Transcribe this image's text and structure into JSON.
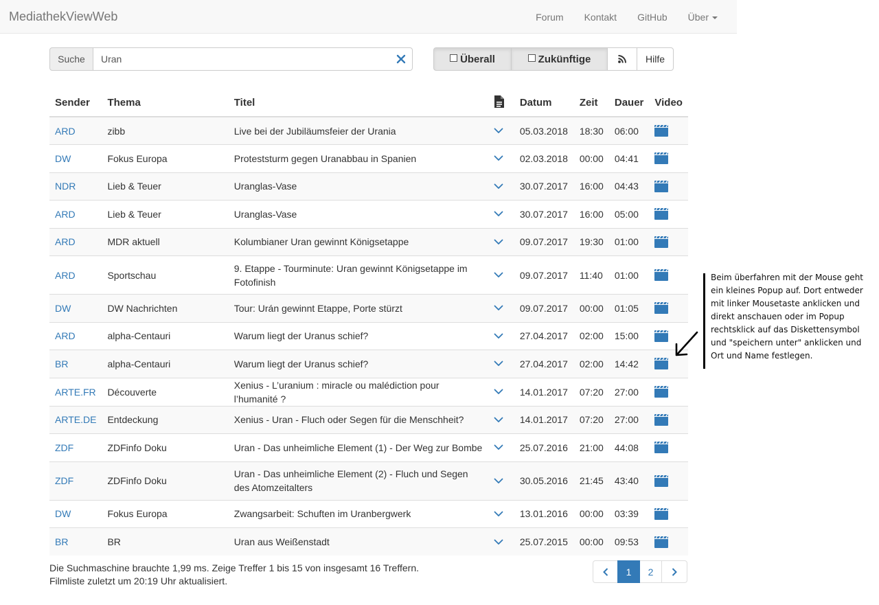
{
  "navbar": {
    "brand": "MediathekViewWeb",
    "links": [
      "Forum",
      "Kontakt",
      "GitHub",
      "Über"
    ]
  },
  "search": {
    "addon_label": "Suche",
    "value": "Uran",
    "clear_icon": "close-icon"
  },
  "toolbar": {
    "everywhere_label": "Überall",
    "future_label": "Zukünftige",
    "rss_icon": "rss-icon",
    "help_label": "Hilfe"
  },
  "table": {
    "headers": {
      "sender": "Sender",
      "thema": "Thema",
      "titel": "Titel",
      "description_icon": "document-icon",
      "datum": "Datum",
      "zeit": "Zeit",
      "dauer": "Dauer",
      "video": "Video"
    },
    "rows": [
      {
        "sender": "ARD",
        "thema": "zibb",
        "titel": "Live bei der Jubiläumsfeier der Urania",
        "datum": "05.03.2018",
        "zeit": "18:30",
        "dauer": "06:00"
      },
      {
        "sender": "DW",
        "thema": "Fokus Europa",
        "titel": "Proteststurm gegen Uranabbau in Spanien",
        "datum": "02.03.2018",
        "zeit": "00:00",
        "dauer": "04:41"
      },
      {
        "sender": "NDR",
        "thema": "Lieb & Teuer",
        "titel": "Uranglas-Vase",
        "datum": "30.07.2017",
        "zeit": "16:00",
        "dauer": "04:43"
      },
      {
        "sender": "ARD",
        "thema": "Lieb & Teuer",
        "titel": "Uranglas-Vase",
        "datum": "30.07.2017",
        "zeit": "16:00",
        "dauer": "05:00"
      },
      {
        "sender": "ARD",
        "thema": "MDR aktuell",
        "titel": "Kolumbianer Uran gewinnt Königsetappe",
        "datum": "09.07.2017",
        "zeit": "19:30",
        "dauer": "01:00"
      },
      {
        "sender": "ARD",
        "thema": "Sportschau",
        "titel": "9. Etappe - Tourminute: Uran gewinnt Königsetappe im Fotofinish",
        "datum": "09.07.2017",
        "zeit": "11:40",
        "dauer": "01:00"
      },
      {
        "sender": "DW",
        "thema": "DW Nachrichten",
        "titel": "Tour: Urán gewinnt Etappe, Porte stürzt",
        "datum": "09.07.2017",
        "zeit": "00:00",
        "dauer": "01:05"
      },
      {
        "sender": "ARD",
        "thema": "alpha-Centauri",
        "titel": "Warum liegt der Uranus schief?",
        "datum": "27.04.2017",
        "zeit": "02:00",
        "dauer": "15:00"
      },
      {
        "sender": "BR",
        "thema": "alpha-Centauri",
        "titel": "Warum liegt der Uranus schief?",
        "datum": "27.04.2017",
        "zeit": "02:00",
        "dauer": "14:42"
      },
      {
        "sender": "ARTE.FR",
        "thema": "Découverte",
        "titel": "Xenius - L’uranium : miracle ou malédiction pour l’humanité ?",
        "datum": "14.01.2017",
        "zeit": "07:20",
        "dauer": "27:00"
      },
      {
        "sender": "ARTE.DE",
        "thema": "Entdeckung",
        "titel": "Xenius - Uran - Fluch oder Segen für die Menschheit?",
        "datum": "14.01.2017",
        "zeit": "07:20",
        "dauer": "27:00"
      },
      {
        "sender": "ZDF",
        "thema": "ZDFinfo Doku",
        "titel": "Uran - Das unheimliche Element (1) - Der Weg zur Bombe",
        "datum": "25.07.2016",
        "zeit": "21:00",
        "dauer": "44:08"
      },
      {
        "sender": "ZDF",
        "thema": "ZDFinfo Doku",
        "titel": "Uran - Das unheimliche Element (2) - Fluch und Segen des Atomzeitalters",
        "datum": "30.05.2016",
        "zeit": "21:45",
        "dauer": "43:40"
      },
      {
        "sender": "DW",
        "thema": "Fokus Europa",
        "titel": "Zwangsarbeit: Schuften im Uranbergwerk",
        "datum": "13.01.2016",
        "zeit": "00:00",
        "dauer": "03:39"
      },
      {
        "sender": "BR",
        "thema": "BR",
        "titel": "Uran aus Weißenstadt",
        "datum": "25.07.2015",
        "zeit": "00:00",
        "dauer": "09:53"
      }
    ]
  },
  "footer": {
    "line1": "Die Suchmaschine brauchte 1,99 ms. Zeige Treffer 1 bis 15 von insgesamt 16 Treffern.",
    "line2": "Filmliste zuletzt um 20:19 Uhr aktualisiert."
  },
  "pagination": {
    "pages": [
      "1",
      "2"
    ],
    "current": "1"
  },
  "annotation": {
    "text": "Beim überfahren mit der Mouse geht ein kleines Popup auf. Dort entweder mit linker Mousetaste anklicken und direkt anschauen oder im Popup rechtsklick auf das Diskettensymbol und \"speichern unter\" anklicken und Ort und Name festlegen."
  },
  "colors": {
    "link": "#337ab7",
    "navbar_bg": "#f8f8f8",
    "stripe": "#f9f9f9"
  }
}
